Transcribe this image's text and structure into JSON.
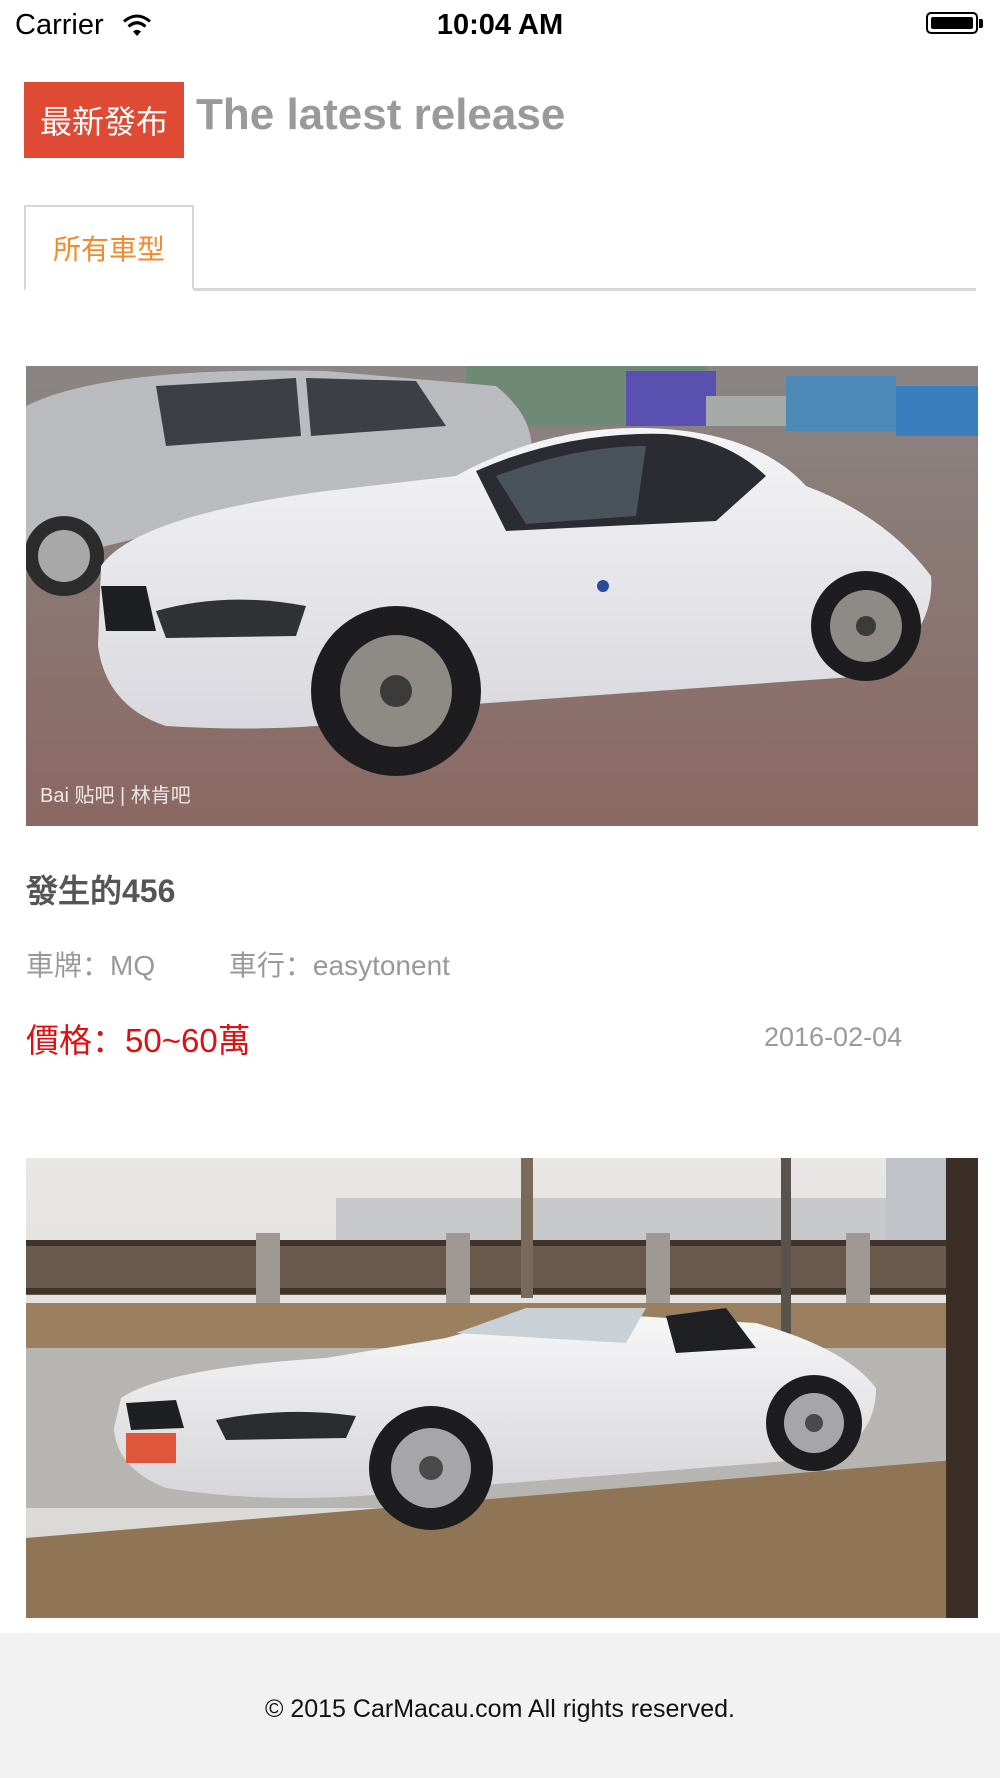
{
  "status_bar": {
    "carrier": "Carrier",
    "time": "10:04 AM",
    "battery_level": 1.0
  },
  "header": {
    "badge": "最新發布",
    "title": "The latest release"
  },
  "tabs": [
    {
      "label": "所有車型",
      "active": true
    }
  ],
  "listings": [
    {
      "name": "發生的456",
      "plate_label": "車牌：",
      "plate": "MQ",
      "dealer_label": "車行：",
      "dealer": "easytonent",
      "price_label": "價格：",
      "price": "50~60萬",
      "date": "2016-02-04",
      "image": "white-bmw-z4-hardtop-photo",
      "watermark": "Bai 贴吧 | 林肯吧"
    },
    {
      "image": "white-bmw-z4-roadster-photo"
    }
  ],
  "footer": {
    "copyright": "© 2015 CarMacau.com All rights reserved."
  },
  "colors": {
    "badge_bg": "#de4a33",
    "tab_active": "#f28a2e",
    "price": "#e00f0f",
    "title_gray": "#9a9a9a",
    "footer_bg": "#f2f2f2"
  }
}
